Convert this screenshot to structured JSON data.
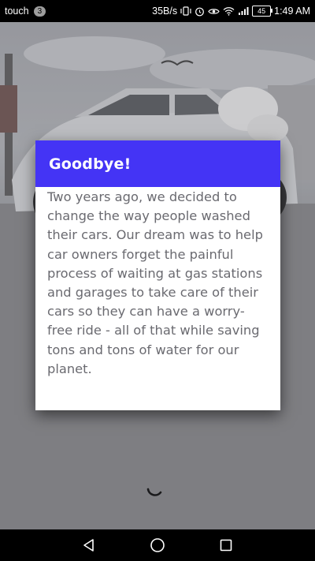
{
  "status_bar": {
    "carrier": "touch",
    "notification_count": "3",
    "net_speed": "35B/s",
    "battery": "45",
    "time": "1:49 AM",
    "icons": [
      "vibrate-icon",
      "alarm-icon",
      "eye-icon",
      "wifi-icon",
      "signal-icon",
      "battery-icon"
    ]
  },
  "dialog": {
    "title": "Goodbye!",
    "body": "Two years ago, we decided to change the way people washed their cars. Our dream was to help car owners forget the painful process of waiting at gas stations and garages to take care of their cars so they can have a worry-free ride - all of that while saving tons and tons of water for our planet."
  },
  "colors": {
    "dialog_header": "#4434f5",
    "dialog_text": "#6a6a70",
    "status_bar": "#000000",
    "nav_bar": "#000000"
  },
  "nav_bar": {
    "icons": [
      "back-icon",
      "home-icon",
      "recents-icon"
    ]
  }
}
